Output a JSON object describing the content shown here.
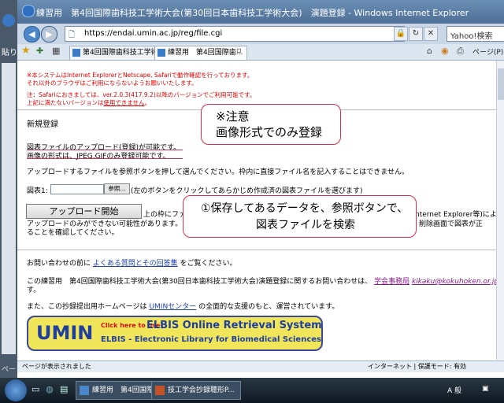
{
  "window": {
    "title": "練習用　第4回国際歯科技工学術大会(第30回日本歯科技工学術大会)　演題登録 - Windows Internet Explorer"
  },
  "left_app": {
    "paste_label": "貼り",
    "page_label": "ペー"
  },
  "address_bar": {
    "url": "https://endai.umin.ac.jp/reg/file.cgi"
  },
  "search_box": {
    "placeholder": "Yahoo!検索"
  },
  "tabs": [
    {
      "label": "第4回国際歯科技工学術..."
    },
    {
      "label": "練習用　第4回国際歯..."
    }
  ],
  "page_menu": {
    "label": "ページ(P)"
  },
  "page": {
    "notice_red_1": "※本システムはInternet ExplorerとNetscape, Safariで動作確認を行っております。",
    "notice_red_2": "それ以外のブラウザはご利用にならないようお願いいたします。",
    "notice_red_3": "注：Safariにおきましては、ver.2.0.3(417.9.2)以降のバージョンでご利用可能です。",
    "notice_red_4_a": "上記に満たないバージョンは",
    "notice_red_4_link": "使用できません",
    "notice_red_4_b": "。",
    "section_title": "新規登録",
    "info_1": "図表ファイルのアップロード(登録)が可能です。",
    "info_2": "画像の形式は、JPEG,GIFのみ登録可能です。",
    "instruction": "アップロードするファイルを参照ボタンを押して選んでください。枠内に直接ファイル名を記入することはできません。",
    "file_label": "図表1:",
    "browse_button": "参照...",
    "file_hint": "(左のボタンをクリックしてあらかじめ作成済の図表ファイルを選びます)",
    "upload_button": "アップロード開始",
    "upload_note_1": "上の枠にファイル",
    "upload_note_1_end": "nternet Explorer等)によ",
    "upload_note_2": "アップロードのみができない可能性があります。ご注意くだ",
    "upload_note_2_end": "削除画面で図表が正",
    "upload_note_3": "ることを確認してください。",
    "faq_before": "お問い合わせの前に",
    "faq_link": "よくある質問とその回答集",
    "faq_after": "をご覧ください。",
    "contact_1": "この練習用　第4回国際歯科技工学術大会(第30回日本歯科技工学術大会)演題登録に関するお問い合わせは、",
    "contact_link": "学会事務局",
    "contact_email": "kikaku@kokuhoken.or.jp",
    "contact_end": "ま",
    "contact_2": "す。",
    "support_before": "また、この抄録提出用ホームページは",
    "support_link": "UMINセンター",
    "support_after": "の全面的な支援のもと、運営されています。"
  },
  "callouts": {
    "note_line1": "※注意",
    "note_line2": "画像形式でのみ登録",
    "save_line1": "①保存してあるデータを、参照ボタンで、",
    "save_line2": "図表ファイルを検索"
  },
  "banner": {
    "logo": "UMIN",
    "click_text": "Click here to use",
    "system_name": "ELBIS Online Retrieval System",
    "subtitle": "ELBIS - Electronic Library for Biomedical Sciences"
  },
  "status": {
    "text": "ページが表示されました",
    "zone": "インターネット | 保護モード: 有効"
  },
  "taskbar": {
    "items": [
      {
        "label": "練習用　第4回国際..."
      },
      {
        "label": "技工学会抄録聴形P..."
      }
    ],
    "tray": "A 般"
  }
}
